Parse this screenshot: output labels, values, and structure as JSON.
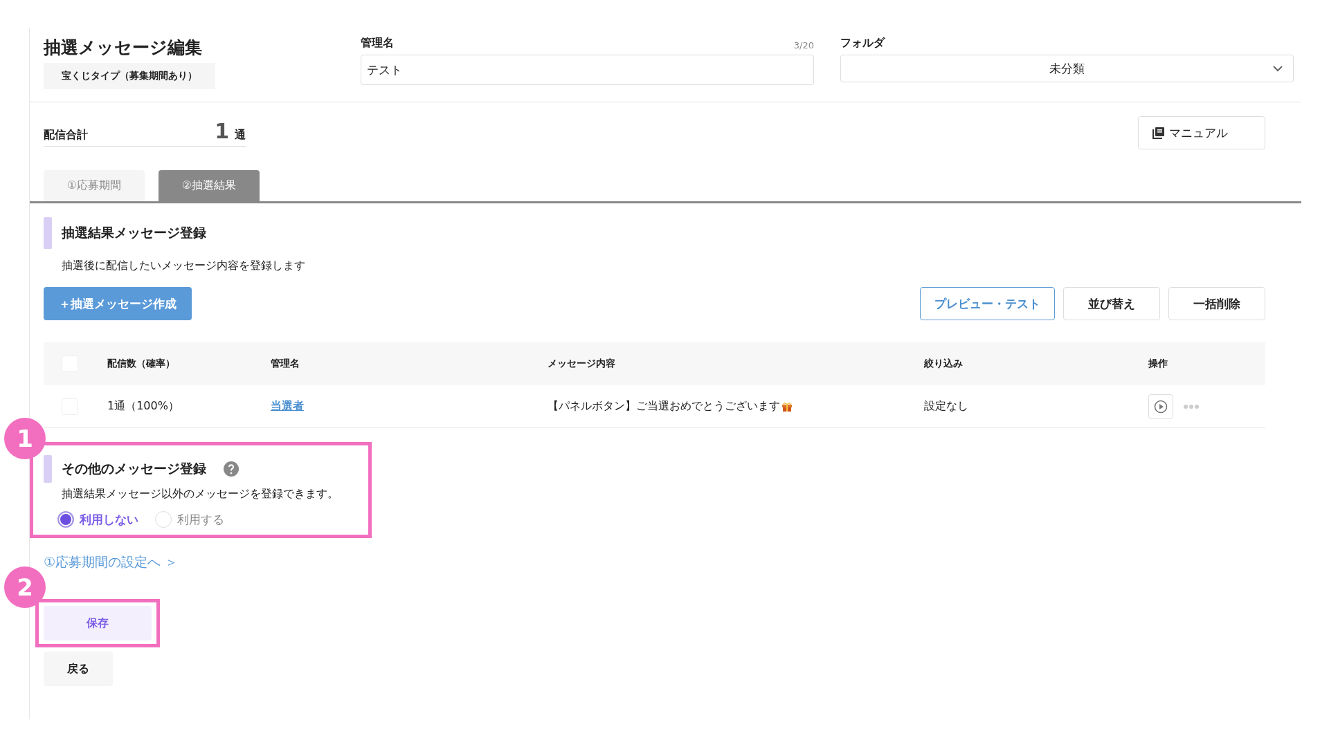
{
  "page": {
    "title": "抽選メッセージ編集",
    "type_badge": "宝くじタイプ（募集期間あり）"
  },
  "name_field": {
    "label": "管理名",
    "counter": "3/20",
    "value": "テスト"
  },
  "folder_field": {
    "label": "フォルダ",
    "value": "未分類"
  },
  "total": {
    "label": "配信合計",
    "count": "1",
    "unit": "通"
  },
  "manual_button": "マニュアル",
  "tabs": [
    {
      "label": "①応募期間",
      "selected": false
    },
    {
      "label": "②抽選結果",
      "selected": true
    }
  ],
  "result_section": {
    "title": "抽選結果メッセージ登録",
    "description": "抽選後に配信したいメッセージ内容を登録します",
    "create_button": "＋抽選メッセージ作成",
    "actions": [
      {
        "label": "プレビュー・テスト",
        "kind": "primary"
      },
      {
        "label": "並び替え",
        "kind": "default"
      },
      {
        "label": "一括削除",
        "kind": "default"
      }
    ]
  },
  "table": {
    "columns": [
      "配信数（確率）",
      "管理名",
      "メッセージ内容",
      "絞り込み",
      "操作"
    ],
    "header_checked": false,
    "rows": [
      {
        "checked": false,
        "count": "1通（100%）",
        "name": "当選者",
        "message": "【パネルボタン】ご当選おめでとうございます",
        "filter": "設定なし"
      }
    ]
  },
  "other_section": {
    "title": "その他のメッセージ登録",
    "description": "抽選結果メッセージ以外のメッセージを登録できます。",
    "options": [
      {
        "label": "利用しない",
        "selected": true
      },
      {
        "label": "利用する",
        "selected": false
      }
    ]
  },
  "link": "①応募期間の設定へ ＞",
  "buttons": [
    {
      "label": "保存",
      "kind": "save"
    },
    {
      "label": "戻る",
      "kind": "back"
    }
  ],
  "annotations": [
    {
      "label": "1"
    },
    {
      "label": "2"
    }
  ]
}
